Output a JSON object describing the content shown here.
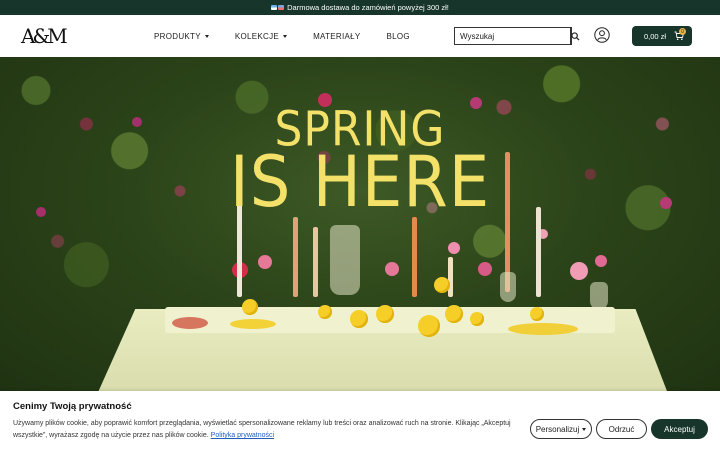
{
  "announcement": {
    "text": "Darmowa dostawa do zamówień powyżej 300 zł!"
  },
  "header": {
    "logo_text": "A&M",
    "nav": [
      {
        "label": "PRODUKTY",
        "has_dropdown": true
      },
      {
        "label": "KOLEKCJE",
        "has_dropdown": true
      },
      {
        "label": "MATERIAŁY",
        "has_dropdown": false
      },
      {
        "label": "BLOG",
        "has_dropdown": false
      }
    ],
    "search": {
      "placeholder": "Wyszukaj"
    },
    "cart": {
      "total": "0,00 zł",
      "count": "0"
    }
  },
  "hero": {
    "line1": "SPRING",
    "line2": "IS HERE"
  },
  "cookie": {
    "title": "Cenimy Twoją prywatność",
    "text": "Używamy plików cookie, aby poprawić komfort przeglądania, wyświetlać spersonalizowane reklamy lub treści oraz analizować ruch na stronie. Klikając „Akceptuj wszystkie”, wyrażasz zgodę na użycie przez nas plików cookie.",
    "link": "Polityka prywatności",
    "buttons": {
      "personalize": "Personalizuj",
      "reject": "Odrzuć",
      "accept": "Akceptuj"
    }
  },
  "colors": {
    "brand_dark": "#17352b",
    "hero_title": "#f3e16a",
    "badge": "#e8b34a"
  },
  "icons": [
    "search-icon",
    "account-icon",
    "cart-icon",
    "caret-down-icon"
  ]
}
